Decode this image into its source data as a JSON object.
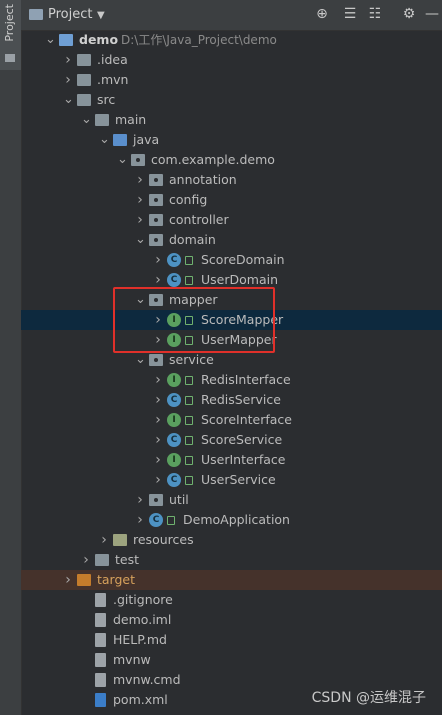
{
  "side_tab": {
    "label": "Project"
  },
  "header": {
    "title": "Project",
    "caret": "▼",
    "icons": [
      "⊕",
      "☰",
      "☷",
      "⚙",
      "—"
    ]
  },
  "tree": [
    {
      "label": "demo",
      "hint": "D:\\工作\\Java_Project\\demo",
      "icon": "folder-blue",
      "arrow": "down",
      "depth": 0,
      "state": ""
    },
    {
      "label": ".idea",
      "icon": "folder",
      "arrow": "right",
      "depth": 1,
      "state": ""
    },
    {
      "label": ".mvn",
      "icon": "folder",
      "arrow": "right",
      "depth": 1,
      "state": ""
    },
    {
      "label": "src",
      "icon": "folder",
      "arrow": "down",
      "depth": 1,
      "state": ""
    },
    {
      "label": "main",
      "icon": "folder",
      "arrow": "down",
      "depth": 2,
      "state": ""
    },
    {
      "label": "java",
      "icon": "folder-src",
      "arrow": "down",
      "depth": 3,
      "state": ""
    },
    {
      "label": "com.example.demo",
      "icon": "pkg",
      "arrow": "down",
      "depth": 4,
      "state": ""
    },
    {
      "label": "annotation",
      "icon": "pkg",
      "arrow": "right",
      "depth": 5,
      "state": ""
    },
    {
      "label": "config",
      "icon": "pkg",
      "arrow": "right",
      "depth": 5,
      "state": ""
    },
    {
      "label": "controller",
      "icon": "pkg",
      "arrow": "right",
      "depth": 5,
      "state": ""
    },
    {
      "label": "domain",
      "icon": "pkg",
      "arrow": "down",
      "depth": 5,
      "state": ""
    },
    {
      "label": "ScoreDomain",
      "icon": "class",
      "arrow": "right",
      "depth": 6,
      "state": ""
    },
    {
      "label": "UserDomain",
      "icon": "class",
      "arrow": "right",
      "depth": 6,
      "state": ""
    },
    {
      "label": "mapper",
      "icon": "pkg",
      "arrow": "down",
      "depth": 5,
      "state": ""
    },
    {
      "label": "ScoreMapper",
      "icon": "interface",
      "arrow": "right",
      "depth": 6,
      "state": "selected"
    },
    {
      "label": "UserMapper",
      "icon": "interface",
      "arrow": "right",
      "depth": 6,
      "state": ""
    },
    {
      "label": "service",
      "icon": "pkg",
      "arrow": "down",
      "depth": 5,
      "state": ""
    },
    {
      "label": "RedisInterface",
      "icon": "interface",
      "arrow": "right",
      "depth": 6,
      "state": ""
    },
    {
      "label": "RedisService",
      "icon": "class",
      "arrow": "right",
      "depth": 6,
      "state": ""
    },
    {
      "label": "ScoreInterface",
      "icon": "interface",
      "arrow": "right",
      "depth": 6,
      "state": ""
    },
    {
      "label": "ScoreService",
      "icon": "class",
      "arrow": "right",
      "depth": 6,
      "state": ""
    },
    {
      "label": "UserInterface",
      "icon": "interface",
      "arrow": "right",
      "depth": 6,
      "state": ""
    },
    {
      "label": "UserService",
      "icon": "class",
      "arrow": "right",
      "depth": 6,
      "state": ""
    },
    {
      "label": "util",
      "icon": "pkg",
      "arrow": "right",
      "depth": 5,
      "state": ""
    },
    {
      "label": "DemoApplication",
      "icon": "spring-class",
      "arrow": "right",
      "depth": 5,
      "state": ""
    },
    {
      "label": "resources",
      "icon": "folder-res",
      "arrow": "right",
      "depth": 3,
      "state": ""
    },
    {
      "label": "test",
      "icon": "folder-test",
      "arrow": "right",
      "depth": 2,
      "state": ""
    },
    {
      "label": "target",
      "icon": "folder-target",
      "arrow": "right",
      "depth": 1,
      "state": "excluded"
    },
    {
      "label": ".gitignore",
      "icon": "file",
      "arrow": "",
      "depth": 2,
      "state": ""
    },
    {
      "label": "demo.iml",
      "icon": "file",
      "arrow": "",
      "depth": 2,
      "state": ""
    },
    {
      "label": "HELP.md",
      "icon": "file",
      "arrow": "",
      "depth": 2,
      "state": ""
    },
    {
      "label": "mvnw",
      "icon": "file",
      "arrow": "",
      "depth": 2,
      "state": ""
    },
    {
      "label": "mvnw.cmd",
      "icon": "file",
      "arrow": "",
      "depth": 2,
      "state": ""
    },
    {
      "label": "pom.xml",
      "icon": "maven-file",
      "arrow": "",
      "depth": 2,
      "state": ""
    }
  ],
  "watermark": "CSDN @运维混子",
  "colors": {
    "background": "#2b2d30",
    "selection": "#0d293e",
    "highlight_box": "#e0302a",
    "excluded": "#45322b"
  }
}
